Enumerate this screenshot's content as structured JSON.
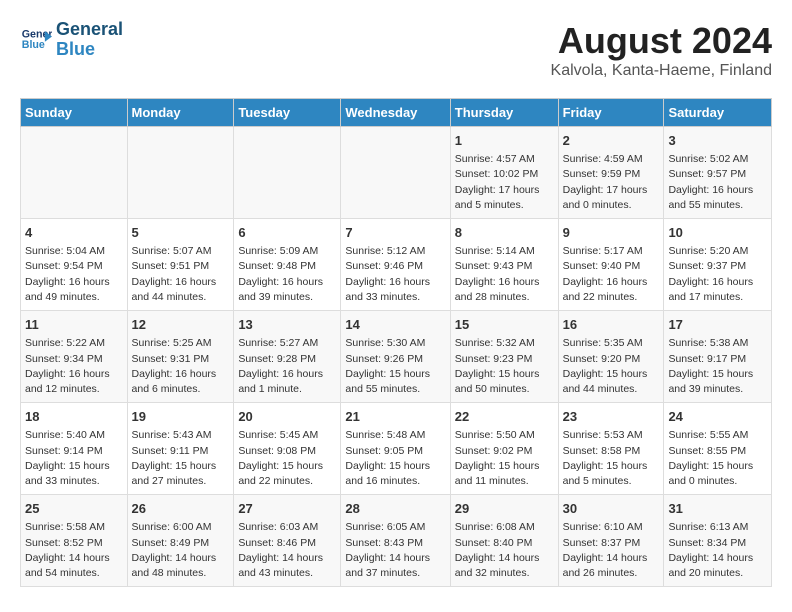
{
  "logo": {
    "line1": "General",
    "line2": "Blue"
  },
  "title": "August 2024",
  "subtitle": "Kalvola, Kanta-Haeme, Finland",
  "weekdays": [
    "Sunday",
    "Monday",
    "Tuesday",
    "Wednesday",
    "Thursday",
    "Friday",
    "Saturday"
  ],
  "weeks": [
    [
      {
        "day": "",
        "info": ""
      },
      {
        "day": "",
        "info": ""
      },
      {
        "day": "",
        "info": ""
      },
      {
        "day": "",
        "info": ""
      },
      {
        "day": "1",
        "info": "Sunrise: 4:57 AM\nSunset: 10:02 PM\nDaylight: 17 hours\nand 5 minutes."
      },
      {
        "day": "2",
        "info": "Sunrise: 4:59 AM\nSunset: 9:59 PM\nDaylight: 17 hours\nand 0 minutes."
      },
      {
        "day": "3",
        "info": "Sunrise: 5:02 AM\nSunset: 9:57 PM\nDaylight: 16 hours\nand 55 minutes."
      }
    ],
    [
      {
        "day": "4",
        "info": "Sunrise: 5:04 AM\nSunset: 9:54 PM\nDaylight: 16 hours\nand 49 minutes."
      },
      {
        "day": "5",
        "info": "Sunrise: 5:07 AM\nSunset: 9:51 PM\nDaylight: 16 hours\nand 44 minutes."
      },
      {
        "day": "6",
        "info": "Sunrise: 5:09 AM\nSunset: 9:48 PM\nDaylight: 16 hours\nand 39 minutes."
      },
      {
        "day": "7",
        "info": "Sunrise: 5:12 AM\nSunset: 9:46 PM\nDaylight: 16 hours\nand 33 minutes."
      },
      {
        "day": "8",
        "info": "Sunrise: 5:14 AM\nSunset: 9:43 PM\nDaylight: 16 hours\nand 28 minutes."
      },
      {
        "day": "9",
        "info": "Sunrise: 5:17 AM\nSunset: 9:40 PM\nDaylight: 16 hours\nand 22 minutes."
      },
      {
        "day": "10",
        "info": "Sunrise: 5:20 AM\nSunset: 9:37 PM\nDaylight: 16 hours\nand 17 minutes."
      }
    ],
    [
      {
        "day": "11",
        "info": "Sunrise: 5:22 AM\nSunset: 9:34 PM\nDaylight: 16 hours\nand 12 minutes."
      },
      {
        "day": "12",
        "info": "Sunrise: 5:25 AM\nSunset: 9:31 PM\nDaylight: 16 hours\nand 6 minutes."
      },
      {
        "day": "13",
        "info": "Sunrise: 5:27 AM\nSunset: 9:28 PM\nDaylight: 16 hours\nand 1 minute."
      },
      {
        "day": "14",
        "info": "Sunrise: 5:30 AM\nSunset: 9:26 PM\nDaylight: 15 hours\nand 55 minutes."
      },
      {
        "day": "15",
        "info": "Sunrise: 5:32 AM\nSunset: 9:23 PM\nDaylight: 15 hours\nand 50 minutes."
      },
      {
        "day": "16",
        "info": "Sunrise: 5:35 AM\nSunset: 9:20 PM\nDaylight: 15 hours\nand 44 minutes."
      },
      {
        "day": "17",
        "info": "Sunrise: 5:38 AM\nSunset: 9:17 PM\nDaylight: 15 hours\nand 39 minutes."
      }
    ],
    [
      {
        "day": "18",
        "info": "Sunrise: 5:40 AM\nSunset: 9:14 PM\nDaylight: 15 hours\nand 33 minutes."
      },
      {
        "day": "19",
        "info": "Sunrise: 5:43 AM\nSunset: 9:11 PM\nDaylight: 15 hours\nand 27 minutes."
      },
      {
        "day": "20",
        "info": "Sunrise: 5:45 AM\nSunset: 9:08 PM\nDaylight: 15 hours\nand 22 minutes."
      },
      {
        "day": "21",
        "info": "Sunrise: 5:48 AM\nSunset: 9:05 PM\nDaylight: 15 hours\nand 16 minutes."
      },
      {
        "day": "22",
        "info": "Sunrise: 5:50 AM\nSunset: 9:02 PM\nDaylight: 15 hours\nand 11 minutes."
      },
      {
        "day": "23",
        "info": "Sunrise: 5:53 AM\nSunset: 8:58 PM\nDaylight: 15 hours\nand 5 minutes."
      },
      {
        "day": "24",
        "info": "Sunrise: 5:55 AM\nSunset: 8:55 PM\nDaylight: 15 hours\nand 0 minutes."
      }
    ],
    [
      {
        "day": "25",
        "info": "Sunrise: 5:58 AM\nSunset: 8:52 PM\nDaylight: 14 hours\nand 54 minutes."
      },
      {
        "day": "26",
        "info": "Sunrise: 6:00 AM\nSunset: 8:49 PM\nDaylight: 14 hours\nand 48 minutes."
      },
      {
        "day": "27",
        "info": "Sunrise: 6:03 AM\nSunset: 8:46 PM\nDaylight: 14 hours\nand 43 minutes."
      },
      {
        "day": "28",
        "info": "Sunrise: 6:05 AM\nSunset: 8:43 PM\nDaylight: 14 hours\nand 37 minutes."
      },
      {
        "day": "29",
        "info": "Sunrise: 6:08 AM\nSunset: 8:40 PM\nDaylight: 14 hours\nand 32 minutes."
      },
      {
        "day": "30",
        "info": "Sunrise: 6:10 AM\nSunset: 8:37 PM\nDaylight: 14 hours\nand 26 minutes."
      },
      {
        "day": "31",
        "info": "Sunrise: 6:13 AM\nSunset: 8:34 PM\nDaylight: 14 hours\nand 20 minutes."
      }
    ]
  ]
}
